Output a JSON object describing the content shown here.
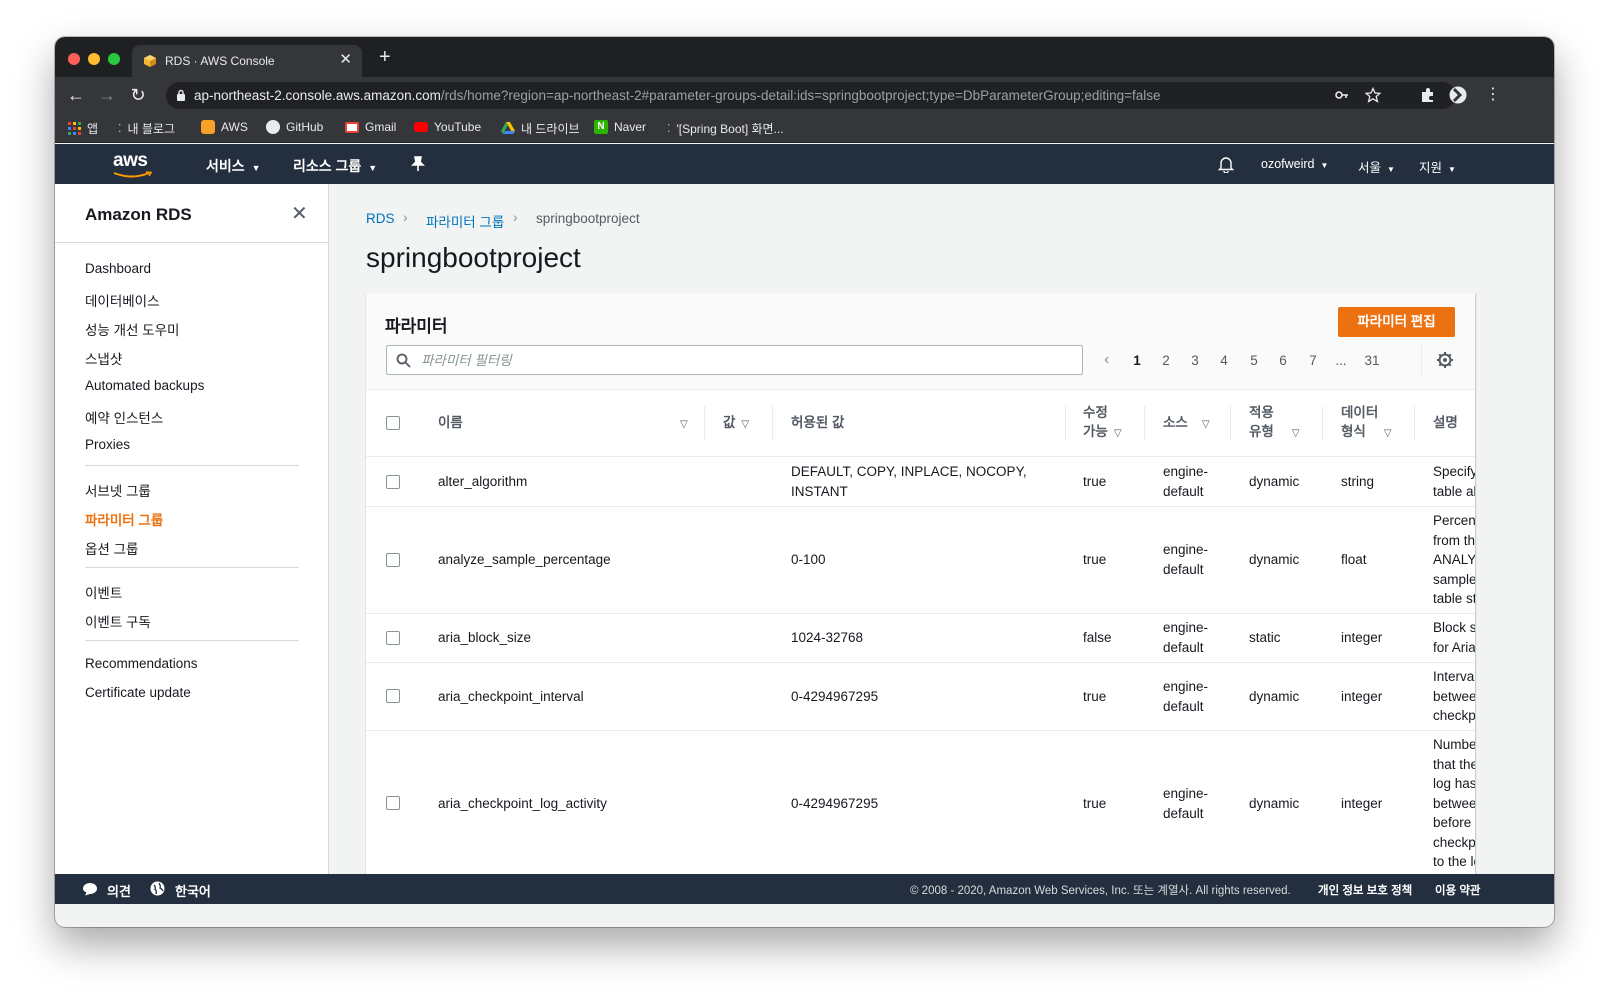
{
  "browser": {
    "tab_title": "RDS · AWS Console",
    "url_host": "ap-northeast-2.console.aws.amazon.com",
    "url_path": "/rds/home?region=ap-northeast-2#parameter-groups-detail:ids=springbootproject;type=DbParameterGroup;editing=false",
    "bookmarks": [
      "앱",
      "내 블로그",
      "AWS",
      "GitHub",
      "Gmail",
      "YouTube",
      "내 드라이브",
      "Naver",
      "'[Spring Boot] 화면..."
    ]
  },
  "aws_nav": {
    "logo": "aws",
    "services": "서비스",
    "resource_groups": "리소스 그룹",
    "user": "ozofweird",
    "region": "서울",
    "support": "지원"
  },
  "sidebar": {
    "title": "Amazon RDS",
    "items": [
      "Dashboard",
      "데이터베이스",
      "성능 개선 도우미",
      "스냅샷",
      "Automated backups",
      "예약 인스턴스",
      "Proxies",
      "서브넷 그룹",
      "파라미터 그룹",
      "옵션 그룹",
      "이벤트",
      "이벤트 구독",
      "Recommendations",
      "Certificate update"
    ],
    "active_item": "파라미터 그룹"
  },
  "breadcrumb": [
    "RDS",
    "파라미터 그룹",
    "springbootproject"
  ],
  "page_title": "springbootproject",
  "panel": {
    "title": "파라미터",
    "edit_button": "파라미터 편집",
    "filter_placeholder": "파라미터 필터링",
    "pages": [
      "1",
      "2",
      "3",
      "4",
      "5",
      "6",
      "7",
      "...",
      "31"
    ],
    "current_page": "1"
  },
  "table": {
    "columns": {
      "name": "이름",
      "value": "값",
      "allowed": "허용된 값",
      "modifiable_1": "수정",
      "modifiable_2": "가능",
      "source": "소스",
      "apply_1": "적용",
      "apply_2": "유형",
      "dtype_1": "데이터",
      "dtype_2": "형식",
      "description": "설명"
    },
    "rows": [
      {
        "name": "alter_algorithm",
        "allowed_1": "DEFAULT, COPY, INPLACE, NOCOPY,",
        "allowed_2": "INSTANT",
        "modifiable": "true",
        "source_1": "engine-",
        "source_2": "default",
        "apply": "dynamic",
        "dtype": "string",
        "desc": [
          "Specify the a",
          "table algorith"
        ]
      },
      {
        "name": "analyze_sample_percentage",
        "allowed_1": "0-100",
        "allowed_2": "",
        "modifiable": "true",
        "source_1": "engine-",
        "source_2": "default",
        "apply": "dynamic",
        "dtype": "float",
        "desc": [
          "Percentage o",
          "from the tabl",
          "ANALYZE TAB",
          "sample to co",
          "table statistic"
        ]
      },
      {
        "name": "aria_block_size",
        "allowed_1": "1024-32768",
        "allowed_2": "",
        "modifiable": "false",
        "source_1": "engine-",
        "source_2": "default",
        "apply": "static",
        "dtype": "integer",
        "desc": [
          "Block size to",
          "for Aria index"
        ]
      },
      {
        "name": "aria_checkpoint_interval",
        "allowed_1": "0-4294967295",
        "allowed_2": "",
        "modifiable": "true",
        "source_1": "engine-",
        "source_2": "default",
        "apply": "dynamic",
        "dtype": "integer",
        "desc": [
          "Interval in se",
          "between auto",
          "checkpoints."
        ]
      },
      {
        "name": "aria_checkpoint_log_activity",
        "allowed_1": "0-4294967295",
        "allowed_2": "",
        "modifiable": "true",
        "source_1": "engine-",
        "source_2": "default",
        "apply": "dynamic",
        "dtype": "integer",
        "desc": [
          "Number of by",
          "that the trans",
          "log has to gro",
          "between chec",
          "before a new",
          "checkpoint is",
          "to the log."
        ]
      }
    ]
  },
  "footer": {
    "feedback": "의견",
    "language": "한국어",
    "copyright": "© 2008 - 2020, Amazon Web Services, Inc. 또는 계열사. All rights reserved.",
    "privacy": "개인 정보 보호 정책",
    "terms": "이용 약관"
  },
  "colors": {
    "aws_nav": "#232f3e",
    "accent_orange": "#ec7211",
    "link_blue": "#0073bb"
  }
}
